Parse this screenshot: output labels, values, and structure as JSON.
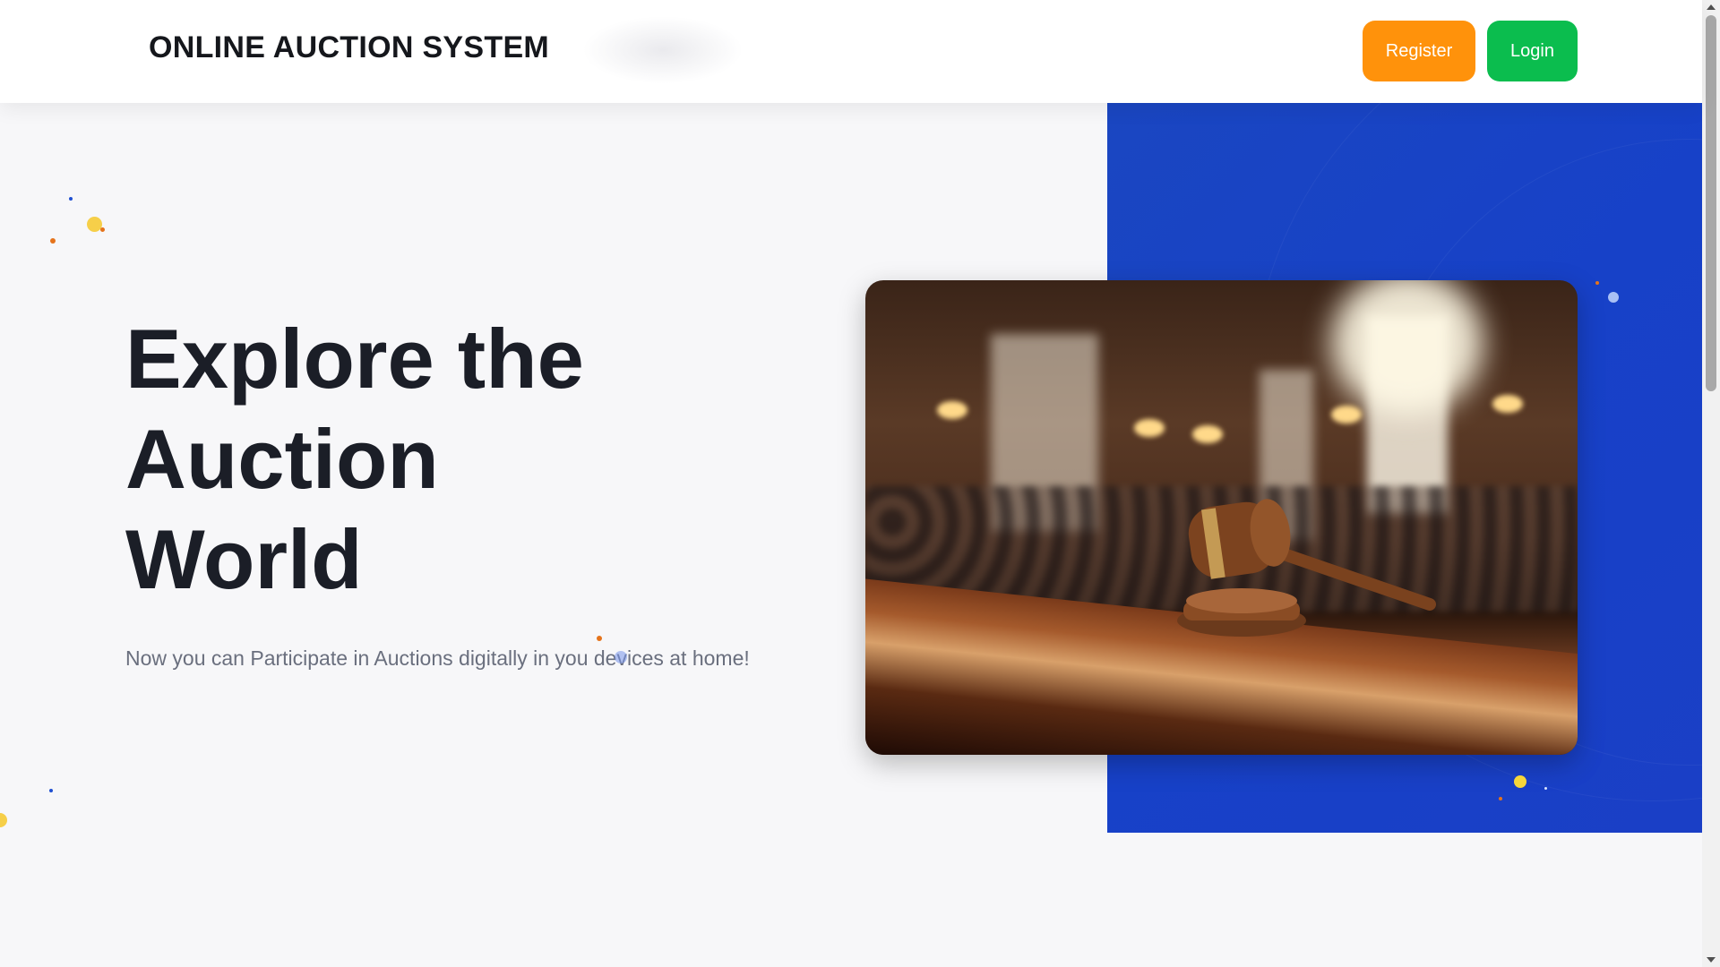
{
  "header": {
    "brand": "ONLINE AUCTION SYSTEM",
    "register_label": "Register",
    "login_label": "Login"
  },
  "hero": {
    "title_line1": "Explore the",
    "title_line2": "Auction",
    "title_line3": "World",
    "subtitle": "Now you can Participate in Auctions digitally in you devices at home!"
  },
  "colors": {
    "register": "#ff920b",
    "login": "#0bbd4e",
    "panel_blue": "#1741c8",
    "title": "#1b1e27"
  },
  "icons": {
    "scroll_up": "triangle-up",
    "scroll_down": "triangle-down"
  }
}
